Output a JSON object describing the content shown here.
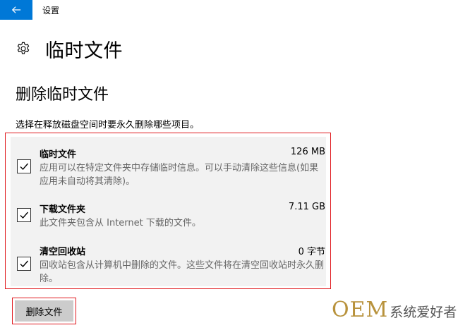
{
  "window": {
    "title": "设置",
    "back_icon": "arrow-left-icon"
  },
  "header": {
    "icon": "gear-icon",
    "title": "临时文件"
  },
  "section": {
    "title": "删除临时文件",
    "description": "选择在释放磁盘空间时要永久删除哪些项目。"
  },
  "items": [
    {
      "name": "临时文件",
      "size": "126 MB",
      "detail": "应用可以在特定文件夹中存储临时信息。可以手动清除这些信息(如果应用未自动将其清除)。",
      "checked": true
    },
    {
      "name": "下载文件夹",
      "size": "7.11 GB",
      "detail": "此文件夹包含从 Internet 下载的文件。",
      "checked": true
    },
    {
      "name": "清空回收站",
      "size": "0 字节",
      "detail": "回收站包含从计算机中删除的文件。这些文件将在清空回收站时永久删除。",
      "checked": true
    }
  ],
  "actions": {
    "delete_label": "删除文件"
  },
  "watermark": {
    "brand": "OEM",
    "text": "系统爱好者"
  },
  "colors": {
    "accent": "#0078d7",
    "highlight": "#e0191e",
    "panel_bg": "#f2f2f2",
    "button_bg": "#cccccc"
  }
}
